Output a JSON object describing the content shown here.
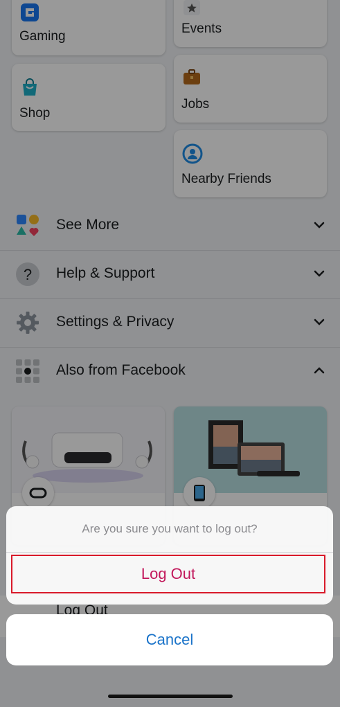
{
  "shortcuts": {
    "gaming": {
      "label": "Gaming",
      "icon": "gaming-icon"
    },
    "events": {
      "label": "Events",
      "icon": "star-icon"
    },
    "shop": {
      "label": "Shop",
      "icon": "shopping-bag-icon"
    },
    "jobs": {
      "label": "Jobs",
      "icon": "briefcase-icon"
    },
    "nearby_friends": {
      "label": "Nearby Friends",
      "icon": "nearby-friends-icon"
    }
  },
  "menu": {
    "see_more": {
      "label": "See More",
      "icon": "shapes-icon",
      "expanded": false
    },
    "help_support": {
      "label": "Help & Support",
      "icon": "question-icon",
      "expanded": false
    },
    "settings_privacy": {
      "label": "Settings & Privacy",
      "icon": "gear-icon",
      "expanded": false
    },
    "also_from_facebook": {
      "label": "Also from Facebook",
      "icon": "grid-icon",
      "expanded": true
    }
  },
  "background_logout_label": "Log Out",
  "dialog": {
    "message": "Are you sure you want to log out?",
    "logout_label": "Log Out",
    "cancel_label": "Cancel"
  },
  "colors": {
    "logout_text": "#c2185b",
    "cancel_text": "#1a73c9",
    "highlight_border": "#d91a2a"
  }
}
